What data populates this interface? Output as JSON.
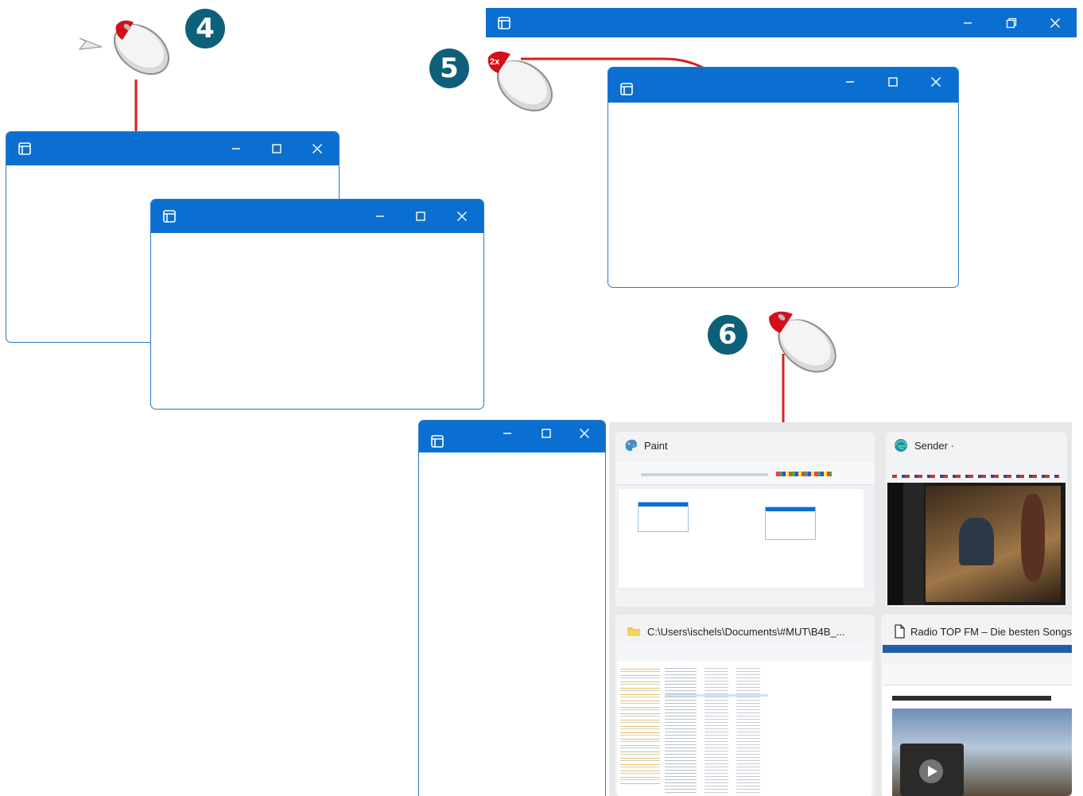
{
  "steps": {
    "step4": "4",
    "step5": "5",
    "step6": "6"
  },
  "mouse_hint": {
    "double_click": "2x"
  },
  "colors": {
    "titlebar": "#0a6fd0",
    "badge": "#0d6079",
    "arrow": "#d42020",
    "mouse_button": "#d40f1a"
  },
  "icons": [
    "app-window-icon",
    "minimize-icon",
    "maximize-icon",
    "restore-icon",
    "close-icon",
    "mouse-icon",
    "paint-icon",
    "edge-icon",
    "folder-icon",
    "document-icon",
    "play-icon"
  ],
  "task_switcher": {
    "cards": [
      {
        "title": "Paint"
      },
      {
        "title": "Sender ·"
      },
      {
        "title": "C:\\Users\\ischels\\Documents\\#MUT\\B4B_..."
      },
      {
        "title": "Radio TOP FM – Die besten Songs a"
      }
    ]
  }
}
